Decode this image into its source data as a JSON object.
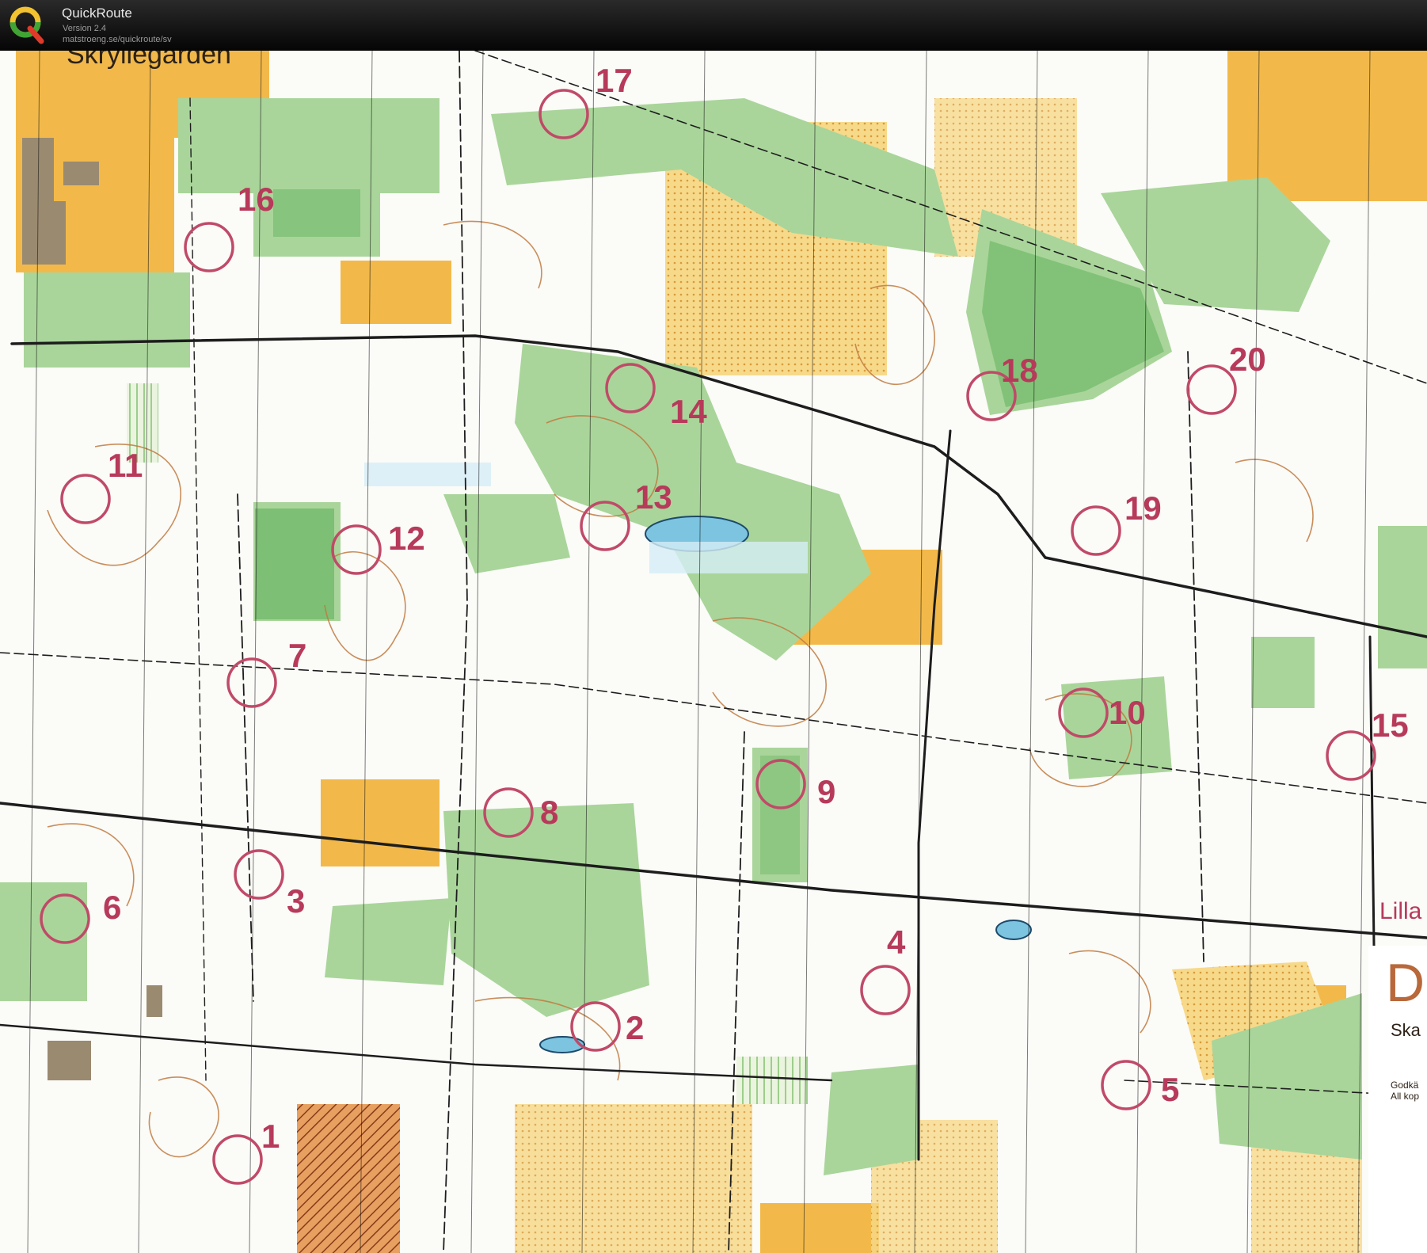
{
  "app": {
    "title": "QuickRoute",
    "version": "Version 2.4",
    "url": "matstroeng.se/quickroute/sv"
  },
  "colors": {
    "control": "#b73a5a",
    "forest_green": "#9dcc8c",
    "dark_green": "#6fb36a",
    "open_yellow": "#f2b94a",
    "rough_yellow": "#f6dc8e",
    "contour_brown": "#b5703a",
    "road_black": "#1d1d1d",
    "water_blue": "#5fb6d8",
    "building_brown": "#c67a3c"
  },
  "map": {
    "place_name": "Skryllegården",
    "edge_text_lilla": "Lilla",
    "edge_text_d": "D",
    "edge_text_ska": "Ska",
    "edge_text_godk": "Godkä",
    "edge_text_allkop": "All kop",
    "controls": [
      {
        "num": "1"
      },
      {
        "num": "2"
      },
      {
        "num": "3"
      },
      {
        "num": "4"
      },
      {
        "num": "5"
      },
      {
        "num": "6"
      },
      {
        "num": "7"
      },
      {
        "num": "8"
      },
      {
        "num": "9"
      },
      {
        "num": "10"
      },
      {
        "num": "11"
      },
      {
        "num": "12"
      },
      {
        "num": "13"
      },
      {
        "num": "14"
      },
      {
        "num": "15"
      },
      {
        "num": "16"
      },
      {
        "num": "17"
      },
      {
        "num": "18"
      },
      {
        "num": "19"
      },
      {
        "num": "20"
      }
    ]
  }
}
